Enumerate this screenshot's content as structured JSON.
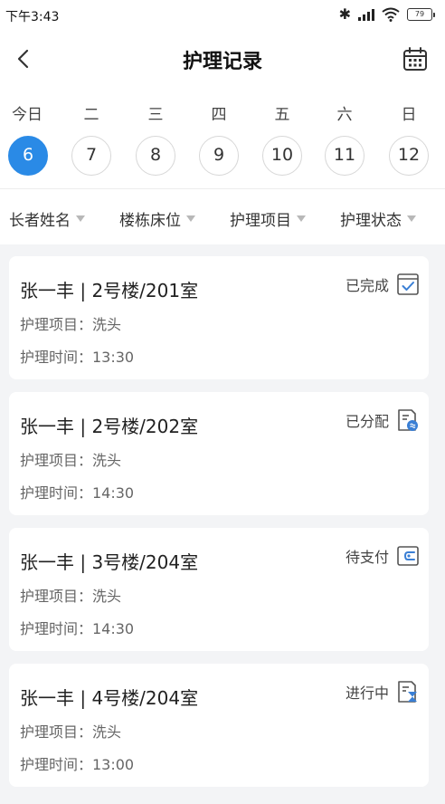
{
  "status_bar": {
    "time": "下午3:43",
    "battery": "79",
    "icons": [
      "bluetooth-icon",
      "signal-icon",
      "wifi-icon",
      "battery-icon"
    ]
  },
  "nav": {
    "title": "护理记录",
    "back_icon": "chevron-left-icon",
    "calendar_icon": "calendar-icon"
  },
  "week": {
    "days": [
      {
        "weekday": "今日",
        "date": "6",
        "selected": true
      },
      {
        "weekday": "二",
        "date": "7",
        "selected": false
      },
      {
        "weekday": "三",
        "date": "8",
        "selected": false
      },
      {
        "weekday": "四",
        "date": "9",
        "selected": false
      },
      {
        "weekday": "五",
        "date": "10",
        "selected": false
      },
      {
        "weekday": "六",
        "date": "11",
        "selected": false
      },
      {
        "weekday": "日",
        "date": "12",
        "selected": false
      }
    ]
  },
  "filters": [
    "长者姓名",
    "楼栋床位",
    "护理项目",
    "护理状态"
  ],
  "records": [
    {
      "title": "张一丰 | 2号楼/201室",
      "item": "护理项目：洗头",
      "time": "护理时间：13:30",
      "status": "已完成",
      "status_icon": "check-box-icon"
    },
    {
      "title": "张一丰 | 2号楼/202室",
      "item": "护理项目：洗头",
      "time": "护理时间：14:30",
      "status": "已分配",
      "status_icon": "assigned-doc-icon"
    },
    {
      "title": "张一丰 | 3号楼/204室",
      "item": "护理项目：洗头",
      "time": "护理时间：14:30",
      "status": "待支付",
      "status_icon": "wallet-icon"
    },
    {
      "title": "张一丰 | 4号楼/204室",
      "item": "护理项目：洗头",
      "time": "护理时间：13:00",
      "status": "进行中",
      "status_icon": "hourglass-doc-icon"
    }
  ],
  "colors": {
    "accent": "#2a8ae6",
    "icon_blue": "#3a7fd5",
    "background": "#f3f4f6"
  }
}
